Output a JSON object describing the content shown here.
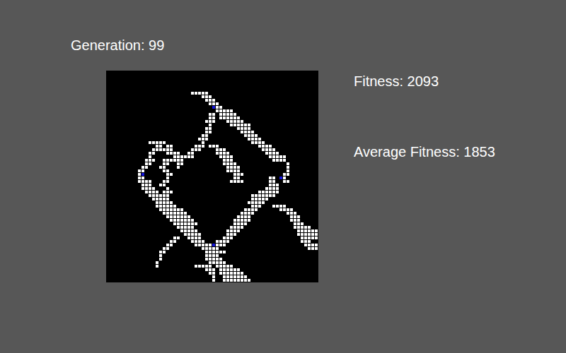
{
  "header": {
    "generation": "Generation: 99"
  },
  "stats": {
    "fitness": "Fitness: 2093",
    "average_fitness": "Average Fitness: 1853"
  },
  "grid": {
    "columns": 60,
    "rows": 60,
    "runs": [
      [
        6,
        24,
        28
      ],
      [
        7,
        27,
        29
      ],
      [
        8,
        28,
        30
      ],
      [
        9,
        29,
        31
      ],
      [
        10,
        30,
        32
      ],
      [
        11,
        31,
        35
      ],
      [
        12,
        29,
        30
      ],
      [
        12,
        32,
        36
      ],
      [
        13,
        29,
        30
      ],
      [
        13,
        32,
        37
      ],
      [
        14,
        28,
        30
      ],
      [
        14,
        34,
        38
      ],
      [
        15,
        29,
        29
      ],
      [
        15,
        35,
        40
      ],
      [
        16,
        28,
        29
      ],
      [
        16,
        37,
        40
      ],
      [
        17,
        28,
        29
      ],
      [
        17,
        38,
        41
      ],
      [
        18,
        27,
        28
      ],
      [
        18,
        39,
        42
      ],
      [
        19,
        26,
        28
      ],
      [
        19,
        40,
        43
      ],
      [
        20,
        12,
        16
      ],
      [
        20,
        27,
        27
      ],
      [
        20,
        41,
        44
      ],
      [
        21,
        14,
        15
      ],
      [
        21,
        17,
        18
      ],
      [
        21,
        25,
        27
      ],
      [
        21,
        29,
        31
      ],
      [
        21,
        43,
        46
      ],
      [
        22,
        13,
        18
      ],
      [
        22,
        24,
        26
      ],
      [
        22,
        31,
        33
      ],
      [
        22,
        44,
        47
      ],
      [
        23,
        12,
        13
      ],
      [
        23,
        17,
        20
      ],
      [
        23,
        23,
        24
      ],
      [
        23,
        31,
        34
      ],
      [
        23,
        45,
        48
      ],
      [
        24,
        12,
        12
      ],
      [
        24,
        19,
        24
      ],
      [
        24,
        32,
        35
      ],
      [
        24,
        46,
        50
      ],
      [
        25,
        11,
        13
      ],
      [
        25,
        16,
        21
      ],
      [
        25,
        33,
        35
      ],
      [
        25,
        47,
        50
      ],
      [
        26,
        11,
        12
      ],
      [
        26,
        16,
        17
      ],
      [
        26,
        20,
        21
      ],
      [
        26,
        33,
        36
      ],
      [
        26,
        51,
        51
      ],
      [
        27,
        10,
        11
      ],
      [
        27,
        15,
        16
      ],
      [
        27,
        20,
        20
      ],
      [
        27,
        34,
        37
      ],
      [
        27,
        51,
        51
      ],
      [
        28,
        9,
        10
      ],
      [
        28,
        16,
        17
      ],
      [
        28,
        34,
        37
      ],
      [
        28,
        51,
        51
      ],
      [
        29,
        9,
        10
      ],
      [
        29,
        17,
        18
      ],
      [
        29,
        36,
        38
      ],
      [
        29,
        50,
        51
      ],
      [
        30,
        9,
        10
      ],
      [
        30,
        17,
        17
      ],
      [
        30,
        36,
        37
      ],
      [
        30,
        46,
        47
      ],
      [
        30,
        49,
        50
      ],
      [
        31,
        9,
        12
      ],
      [
        31,
        16,
        17
      ],
      [
        31,
        35,
        38
      ],
      [
        31,
        46,
        47
      ],
      [
        31,
        50,
        51
      ],
      [
        32,
        10,
        12
      ],
      [
        32,
        15,
        16
      ],
      [
        32,
        46,
        48
      ],
      [
        33,
        10,
        13
      ],
      [
        33,
        17,
        17
      ],
      [
        33,
        45,
        48
      ],
      [
        34,
        11,
        14
      ],
      [
        34,
        16,
        18
      ],
      [
        34,
        43,
        48
      ],
      [
        35,
        12,
        17
      ],
      [
        35,
        41,
        47
      ],
      [
        36,
        13,
        17
      ],
      [
        36,
        41,
        45
      ],
      [
        37,
        14,
        18
      ],
      [
        37,
        40,
        44
      ],
      [
        38,
        14,
        19
      ],
      [
        38,
        41,
        43
      ],
      [
        38,
        47,
        50
      ],
      [
        39,
        15,
        21
      ],
      [
        39,
        39,
        42
      ],
      [
        39,
        49,
        52
      ],
      [
        40,
        16,
        22
      ],
      [
        40,
        38,
        41
      ],
      [
        40,
        51,
        53
      ],
      [
        41,
        17,
        23
      ],
      [
        41,
        37,
        40
      ],
      [
        41,
        52,
        54
      ],
      [
        42,
        18,
        24
      ],
      [
        42,
        36,
        40
      ],
      [
        42,
        52,
        54
      ],
      [
        43,
        19,
        25
      ],
      [
        43,
        36,
        39
      ],
      [
        43,
        53,
        55
      ],
      [
        44,
        20,
        24
      ],
      [
        44,
        35,
        38
      ],
      [
        44,
        53,
        57
      ],
      [
        45,
        21,
        25
      ],
      [
        45,
        34,
        37
      ],
      [
        45,
        54,
        59
      ],
      [
        46,
        22,
        26
      ],
      [
        46,
        34,
        36
      ],
      [
        46,
        54,
        59
      ],
      [
        47,
        19,
        20
      ],
      [
        47,
        23,
        26
      ],
      [
        47,
        33,
        35
      ],
      [
        47,
        55,
        59
      ],
      [
        48,
        18,
        19
      ],
      [
        48,
        24,
        27
      ],
      [
        48,
        31,
        34
      ],
      [
        48,
        55,
        57
      ],
      [
        49,
        17,
        18
      ],
      [
        49,
        25,
        33
      ],
      [
        49,
        56,
        59
      ],
      [
        50,
        16,
        17
      ],
      [
        50,
        27,
        31
      ],
      [
        50,
        57,
        59
      ],
      [
        51,
        15,
        16
      ],
      [
        51,
        28,
        33
      ],
      [
        52,
        15,
        15
      ],
      [
        52,
        28,
        31
      ],
      [
        53,
        15,
        15
      ],
      [
        53,
        28,
        32
      ],
      [
        54,
        14,
        14
      ],
      [
        54,
        29,
        33
      ],
      [
        55,
        14,
        14
      ],
      [
        55,
        25,
        29
      ],
      [
        55,
        31,
        35
      ],
      [
        56,
        28,
        30
      ],
      [
        56,
        32,
        37
      ],
      [
        57,
        29,
        30
      ],
      [
        57,
        32,
        38
      ],
      [
        58,
        30,
        30
      ],
      [
        58,
        33,
        39
      ],
      [
        59,
        30,
        30
      ],
      [
        59,
        33,
        40
      ]
    ],
    "markers": [
      {
        "col": 30,
        "row": 10
      },
      {
        "col": 10,
        "row": 29
      },
      {
        "col": 49,
        "row": 30
      },
      {
        "col": 30,
        "row": 49
      }
    ]
  }
}
